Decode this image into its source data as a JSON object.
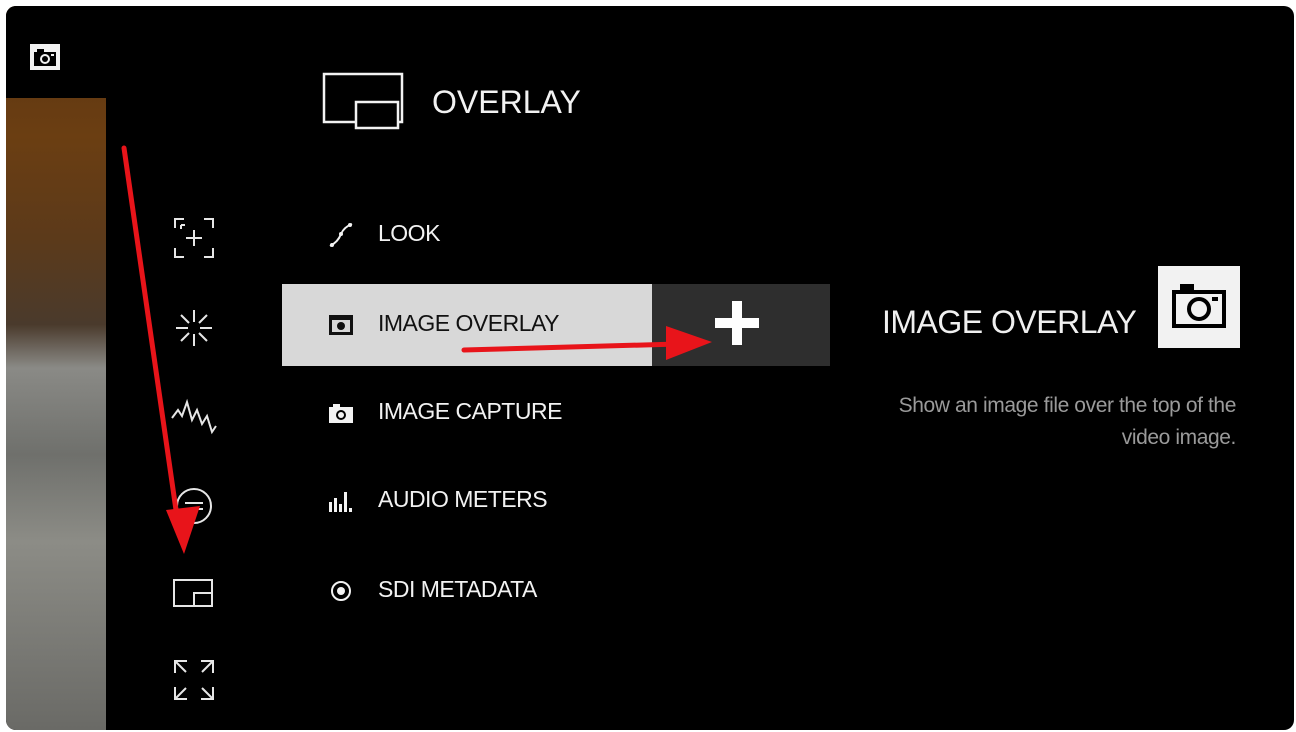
{
  "header": {
    "title": "OVERLAY",
    "icon": "overlay-icon"
  },
  "sidebar": {
    "top_button_icon": "camera-icon",
    "icons": [
      "focus-assist-icon",
      "exposure-icon",
      "waveform-icon",
      "scope-icon",
      "overlay-icon",
      "zoom-expand-icon"
    ]
  },
  "menu": {
    "items": [
      {
        "label": "LOOK",
        "icon": "look-curve-icon"
      },
      {
        "label": "IMAGE OVERLAY",
        "icon": "camera-icon",
        "selected": true
      },
      {
        "label": "IMAGE CAPTURE",
        "icon": "camera-icon"
      },
      {
        "label": "AUDIO METERS",
        "icon": "audio-meters-icon"
      },
      {
        "label": "SDI METADATA",
        "icon": "target-icon"
      }
    ],
    "add_button_icon": "plus-icon"
  },
  "detail": {
    "title": "IMAGE OVERLAY",
    "icon": "camera-icon",
    "description": "Show an image file over the top of the video image."
  },
  "colors": {
    "selected_bg": "#d8d8d8",
    "add_button_bg": "#2e2e2e",
    "annotation_arrow": "#e8141a"
  }
}
